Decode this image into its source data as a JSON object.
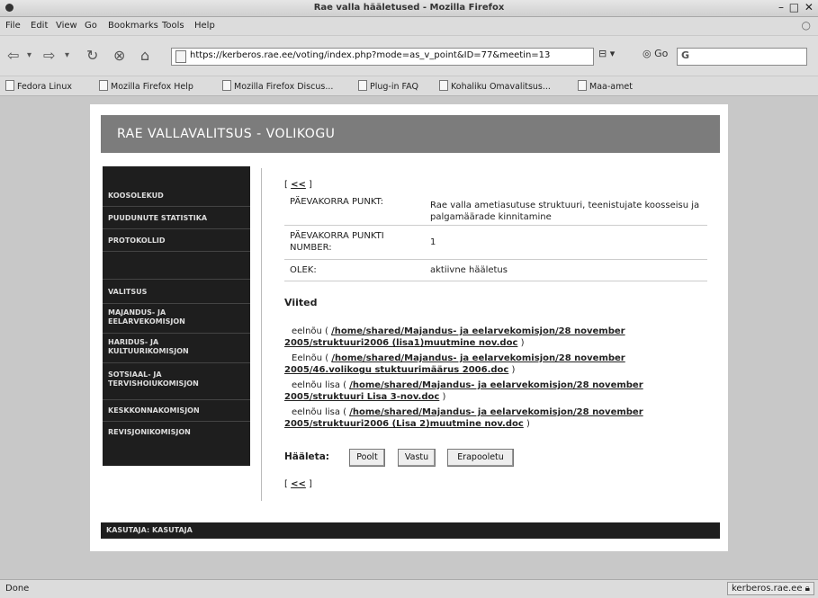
{
  "window": {
    "title": "Rae valla hääletused - Mozilla Firefox"
  },
  "menu": [
    "File",
    "Edit",
    "View",
    "Go",
    "Bookmarks",
    "Tools",
    "Help"
  ],
  "address": {
    "url": "https://kerberos.rae.ee/voting/index.php?mode=as_v_point&ID=77&meetin=13",
    "go_label": "Go"
  },
  "bookmarks": [
    "Fedora Linux",
    "Mozilla Firefox Help",
    "Mozilla Firefox Discus...",
    "Plug-in FAQ",
    "Kohaliku Omavalitsus...",
    "Maa-amet"
  ],
  "page": {
    "header_title": "RAE VALLAVALITSUS - VOLIKOGU",
    "sidebar": [
      {
        "label": "KOOSOLEKUD"
      },
      {
        "label": "PUUDUNUTE STATISTIKA"
      },
      {
        "label": "PROTOKOLLID"
      },
      {
        "label": "VALITSUS"
      },
      {
        "label": "MAJANDUS- JA\nEELARVEKOMISJON"
      },
      {
        "label": "HARIDUS- JA\nKULTUURIKOMISJON"
      },
      {
        "label": "SOTSIAAL- JA\nTERVISHOIUKOMISJON"
      },
      {
        "label": "KESKKONNAKOMISJON"
      },
      {
        "label": "REVISJONIKOMISJON"
      }
    ],
    "back_link": "<<",
    "details": {
      "punkt_label": "PÄEVAKORRA PUNKT:",
      "punkt_value": "Rae valla ametiasutuse struktuuri, teenistujate koosseisu ja palgamäärade kinnitamine",
      "number_label": "PÄEVAKORRA PUNKTI NUMBER:",
      "number_value": "1",
      "olek_label": "OLEK:",
      "olek_value": "aktiivne hääletus"
    },
    "viited_heading": "Viited",
    "references": [
      {
        "prefix": "eelnõu (",
        "link": "/home/shared/Majandus- ja eelarvekomisjon/28 november 2005/struktuuri2006 (lisa1)muutmine nov.doc",
        "suffix": ")"
      },
      {
        "prefix": "Eelnõu (",
        "link": "/home/shared/Majandus- ja eelarvekomisjon/28 november 2005/46.volikogu stuktuurimäärus 2006.doc",
        "suffix": ")"
      },
      {
        "prefix": "eelnõu lisa (",
        "link": "/home/shared/Majandus- ja eelarvekomisjon/28 november 2005/struktuuri Lisa 3-nov.doc",
        "suffix": ")"
      },
      {
        "prefix": "eelnõu lisa (",
        "link": "/home/shared/Majandus- ja eelarvekomisjon/28 november 2005/struktuuri2006 (Lisa 2)muutmine nov.doc",
        "suffix": ")"
      }
    ],
    "vote": {
      "label": "Hääleta:",
      "poolt": "Poolt",
      "vastu": "Vastu",
      "erapooletu": "Erapooletu"
    },
    "footer_user": "KASUTAJA: KASUTAJA"
  },
  "status": {
    "text": "Done",
    "host": "kerberos.rae.ee"
  }
}
